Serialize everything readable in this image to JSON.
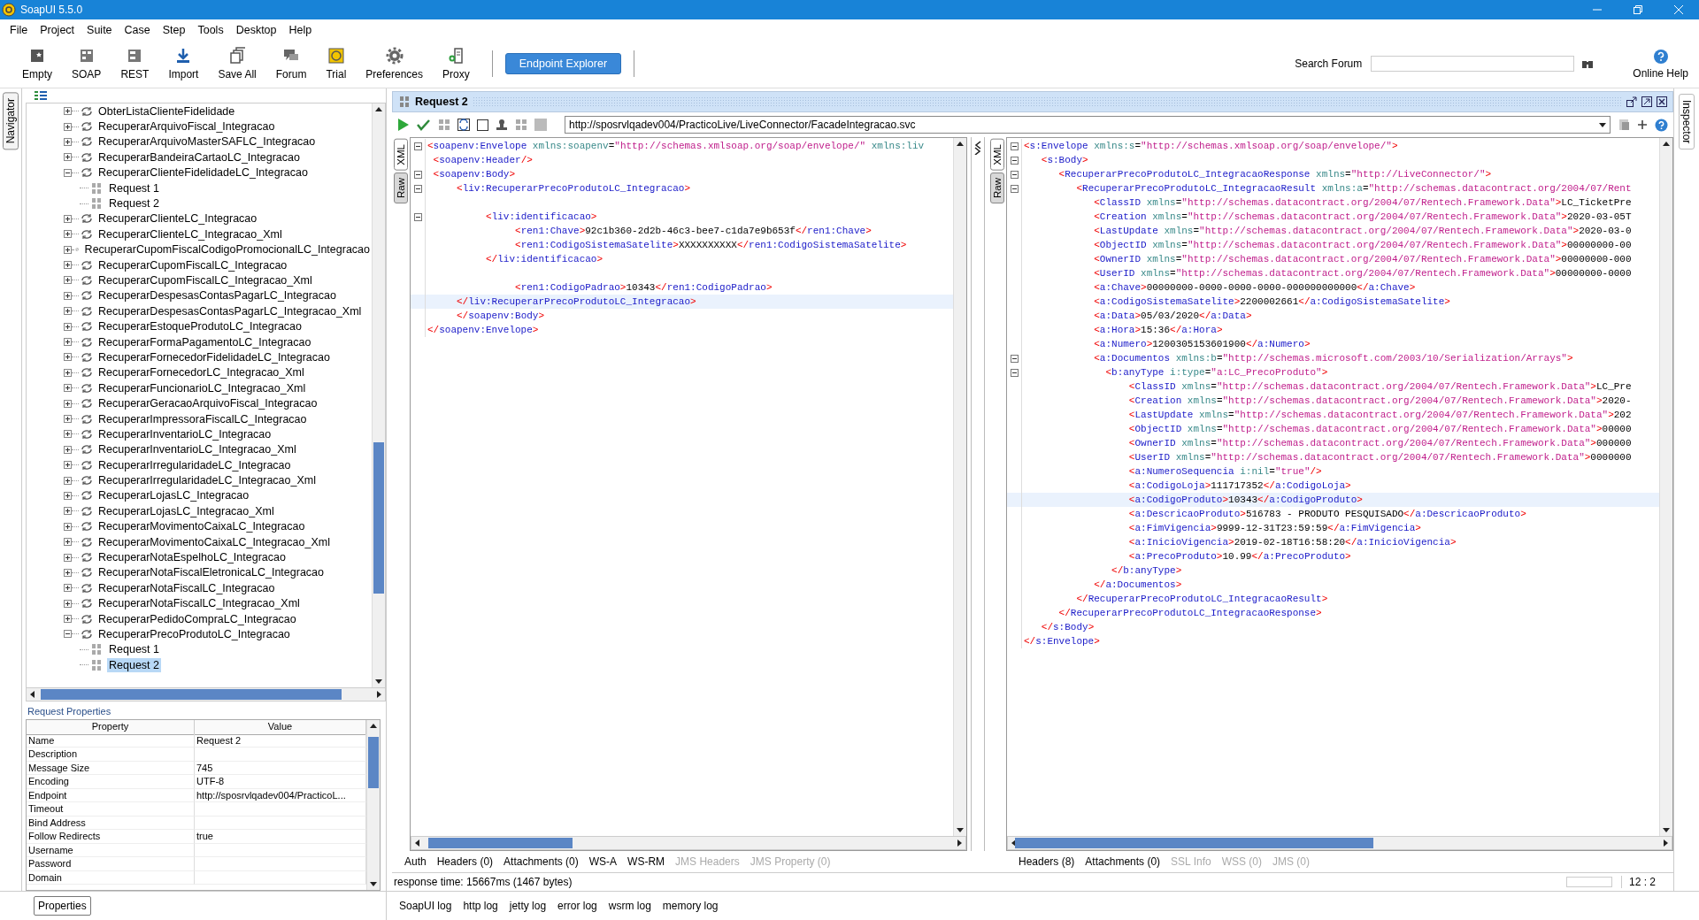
{
  "window": {
    "title": "SoapUI 5.5.0"
  },
  "menu": [
    "File",
    "Project",
    "Suite",
    "Case",
    "Step",
    "Tools",
    "Desktop",
    "Help"
  ],
  "toolbar": [
    "Empty",
    "SOAP",
    "REST",
    "Import",
    "Save All",
    "Forum",
    "Trial",
    "Preferences",
    "Proxy"
  ],
  "endpoint_explorer": "Endpoint Explorer",
  "search": {
    "label": "Search Forum"
  },
  "online_help": "Online Help",
  "navigator": {
    "tab": "Navigator",
    "items": [
      {
        "label": "ObterListaClienteFidelidade",
        "expanded": false,
        "selected": false
      },
      {
        "label": "RecuperarArquivoFiscal_Integracao",
        "expanded": false,
        "selected": false
      },
      {
        "label": "RecuperarArquivoMasterSAFLC_Integracao",
        "expanded": false,
        "selected": false
      },
      {
        "label": "RecuperarBandeiraCartaoLC_Integracao",
        "expanded": false,
        "selected": false
      },
      {
        "label": "RecuperarClienteFidelidadeLC_Integracao",
        "expanded": true,
        "selected": false,
        "children": [
          {
            "label": "Request 1",
            "selected": false
          },
          {
            "label": "Request 2",
            "selected": false
          }
        ]
      },
      {
        "label": "RecuperarClienteLC_Integracao",
        "expanded": false,
        "selected": false
      },
      {
        "label": "RecuperarClienteLC_Integracao_Xml",
        "expanded": false,
        "selected": false
      },
      {
        "label": "RecuperarCupomFiscalCodigoPromocionalLC_Integracao",
        "expanded": false,
        "selected": false
      },
      {
        "label": "RecuperarCupomFiscalLC_Integracao",
        "expanded": false,
        "selected": false
      },
      {
        "label": "RecuperarCupomFiscalLC_Integracao_Xml",
        "expanded": false,
        "selected": false
      },
      {
        "label": "RecuperarDespesasContasPagarLC_Integracao",
        "expanded": false,
        "selected": false
      },
      {
        "label": "RecuperarDespesasContasPagarLC_Integracao_Xml",
        "expanded": false,
        "selected": false
      },
      {
        "label": "RecuperarEstoqueProdutoLC_Integracao",
        "expanded": false,
        "selected": false
      },
      {
        "label": "RecuperarFormaPagamentoLC_Integracao",
        "expanded": false,
        "selected": false
      },
      {
        "label": "RecuperarFornecedorFidelidadeLC_Integracao",
        "expanded": false,
        "selected": false
      },
      {
        "label": "RecuperarFornecedorLC_Integracao_Xml",
        "expanded": false,
        "selected": false
      },
      {
        "label": "RecuperarFuncionarioLC_Integracao_Xml",
        "expanded": false,
        "selected": false
      },
      {
        "label": "RecuperarGeracaoArquivoFiscal_Integracao",
        "expanded": false,
        "selected": false
      },
      {
        "label": "RecuperarImpressoraFiscalLC_Integracao",
        "expanded": false,
        "selected": false
      },
      {
        "label": "RecuperarInventarioLC_Integracao",
        "expanded": false,
        "selected": false
      },
      {
        "label": "RecuperarInventarioLC_Integracao_Xml",
        "expanded": false,
        "selected": false
      },
      {
        "label": "RecuperarIrregularidadeLC_Integracao",
        "expanded": false,
        "selected": false
      },
      {
        "label": "RecuperarIrregularidadeLC_Integracao_Xml",
        "expanded": false,
        "selected": false
      },
      {
        "label": "RecuperarLojasLC_Integracao",
        "expanded": false,
        "selected": false
      },
      {
        "label": "RecuperarLojasLC_Integracao_Xml",
        "expanded": false,
        "selected": false
      },
      {
        "label": "RecuperarMovimentoCaixaLC_Integracao",
        "expanded": false,
        "selected": false
      },
      {
        "label": "RecuperarMovimentoCaixaLC_Integracao_Xml",
        "expanded": false,
        "selected": false
      },
      {
        "label": "RecuperarNotaEspelhoLC_Integracao",
        "expanded": false,
        "selected": false
      },
      {
        "label": "RecuperarNotaFiscalEletronicaLC_Integracao",
        "expanded": false,
        "selected": false
      },
      {
        "label": "RecuperarNotaFiscalLC_Integracao",
        "expanded": false,
        "selected": false
      },
      {
        "label": "RecuperarNotaFiscalLC_Integracao_Xml",
        "expanded": false,
        "selected": false
      },
      {
        "label": "RecuperarPedidoCompraLC_Integracao",
        "expanded": false,
        "selected": false
      },
      {
        "label": "RecuperarPrecoProdutoLC_Integracao",
        "expanded": true,
        "selected": false,
        "children": [
          {
            "label": "Request 1",
            "selected": false
          },
          {
            "label": "Request 2",
            "selected": true
          }
        ]
      }
    ]
  },
  "request_properties": {
    "title": "Request Properties",
    "columns": [
      "Property",
      "Value"
    ],
    "rows": [
      {
        "property": "Name",
        "value": "Request 2"
      },
      {
        "property": "Description"
      },
      {
        "property": "Message Size",
        "value": "745"
      },
      {
        "property": "Encoding",
        "value": "UTF-8"
      },
      {
        "property": "Endpoint",
        "value": "http://sposrvlqadev004/PracticoL..."
      },
      {
        "property": "Timeout"
      },
      {
        "property": "Bind Address"
      },
      {
        "property": "Follow Redirects",
        "value": "true"
      },
      {
        "property": "Username"
      },
      {
        "property": "Password"
      },
      {
        "property": "Domain"
      }
    ]
  },
  "properties_button": "Properties",
  "request": {
    "title": "Request 2",
    "endpoint": "http://sposrvlqadev004/PracticoLive/LiveConnector/FacadeIntegracao.svc",
    "editor_tabs": [
      {
        "label": "XML",
        "selected": true
      },
      {
        "label": "Raw",
        "selected": false
      }
    ],
    "lines": [
      {
        "text": "<soapenv:Envelope xmlns:soapenv=\"http://schemas.xmlsoap.org/soap/envelope/\" xmlns:liv",
        "fold": true,
        "current": false
      },
      {
        "text": " <soapenv:Header/>",
        "fold": false,
        "current": false
      },
      {
        "text": " <soapenv:Body>",
        "fold": true,
        "current": false
      },
      {
        "text": "     <liv:RecuperarPrecoProdutoLC_Integracao>",
        "fold": true,
        "current": false
      },
      {
        "fold": false,
        "current": false
      },
      {
        "text": "          <liv:identificacao>",
        "fold": true,
        "current": false
      },
      {
        "text": "               <ren1:Chave>92c1b360-2d2b-46c3-bee7-c1da7e9b653f</ren1:Chave>",
        "fold": false,
        "current": false
      },
      {
        "text": "               <ren1:CodigoSistemaSatelite>XXXXXXXXXX</ren1:CodigoSistemaSatelite>",
        "fold": false,
        "current": false
      },
      {
        "text": "          </liv:identificacao>",
        "fold": false,
        "current": false
      },
      {
        "fold": false,
        "current": false
      },
      {
        "text": "               <ren1:CodigoPadrao>10343</ren1:CodigoPadrao>",
        "fold": false,
        "current": false
      },
      {
        "text": "     </liv:RecuperarPrecoProdutoLC_Integracao>",
        "fold": false,
        "current": true
      },
      {
        "text": "     </soapenv:Body>",
        "fold": false,
        "current": false
      },
      {
        "text": "</soapenv:Envelope>",
        "fold": false,
        "current": false
      }
    ],
    "tabs": [
      {
        "label": "Auth",
        "disabled": false
      },
      {
        "label": "Headers (0)",
        "disabled": false
      },
      {
        "label": "Attachments (0)",
        "disabled": false
      },
      {
        "label": "WS-A",
        "disabled": false
      },
      {
        "label": "WS-RM",
        "disabled": false
      },
      {
        "label": "JMS Headers",
        "disabled": true
      },
      {
        "label": "JMS Property (0)",
        "disabled": true
      }
    ]
  },
  "response": {
    "editor_tabs": [
      {
        "label": "XML",
        "selected": true
      },
      {
        "label": "Raw",
        "selected": false
      }
    ],
    "lines": [
      {
        "text": "<s:Envelope xmlns:s=\"http://schemas.xmlsoap.org/soap/envelope/\">",
        "fold": true,
        "current": false
      },
      {
        "text": "   <s:Body>",
        "fold": true,
        "current": false
      },
      {
        "text": "      <RecuperarPrecoProdutoLC_IntegracaoResponse xmlns=\"http://LiveConnector/\">",
        "fold": true,
        "current": false
      },
      {
        "text": "         <RecuperarPrecoProdutoLC_IntegracaoResult xmlns:a=\"http://schemas.datacontract.org/2004/07/Rent",
        "fold": true,
        "current": false
      },
      {
        "text": "            <ClassID xmlns=\"http://schemas.datacontract.org/2004/07/Rentech.Framework.Data\">LC_TicketPre",
        "fold": false,
        "current": false
      },
      {
        "text": "            <Creation xmlns=\"http://schemas.datacontract.org/2004/07/Rentech.Framework.Data\">2020-03-05T",
        "fold": false,
        "current": false
      },
      {
        "text": "            <LastUpdate xmlns=\"http://schemas.datacontract.org/2004/07/Rentech.Framework.Data\">2020-03-0",
        "fold": false,
        "current": false
      },
      {
        "text": "            <ObjectID xmlns=\"http://schemas.datacontract.org/2004/07/Rentech.Framework.Data\">00000000-00",
        "fold": false,
        "current": false
      },
      {
        "text": "            <OwnerID xmlns=\"http://schemas.datacontract.org/2004/07/Rentech.Framework.Data\">00000000-000",
        "fold": false,
        "current": false
      },
      {
        "text": "            <UserID xmlns=\"http://schemas.datacontract.org/2004/07/Rentech.Framework.Data\">00000000-0000",
        "fold": false,
        "current": false
      },
      {
        "text": "            <a:Chave>00000000-0000-0000-0000-000000000000</a:Chave>",
        "fold": false,
        "current": false
      },
      {
        "text": "            <a:CodigoSistemaSatelite>2200002661</a:CodigoSistemaSatelite>",
        "fold": false,
        "current": false
      },
      {
        "text": "            <a:Data>05/03/2020</a:Data>",
        "fold": false,
        "current": false
      },
      {
        "text": "            <a:Hora>15:36</a:Hora>",
        "fold": false,
        "current": false
      },
      {
        "text": "            <a:Numero>1200305153601900</a:Numero>",
        "fold": false,
        "current": false
      },
      {
        "text": "            <a:Documentos xmlns:b=\"http://schemas.microsoft.com/2003/10/Serialization/Arrays\">",
        "fold": true,
        "current": false
      },
      {
        "text": "              <b:anyType i:type=\"a:LC_PrecoProduto\">",
        "fold": true,
        "current": false
      },
      {
        "text": "                  <ClassID xmlns=\"http://schemas.datacontract.org/2004/07/Rentech.Framework.Data\">LC_Pre",
        "fold": false,
        "current": false
      },
      {
        "text": "                  <Creation xmlns=\"http://schemas.datacontract.org/2004/07/Rentech.Framework.Data\">2020-",
        "fold": false,
        "current": false
      },
      {
        "text": "                  <LastUpdate xmlns=\"http://schemas.datacontract.org/2004/07/Rentech.Framework.Data\">202",
        "fold": false,
        "current": false
      },
      {
        "text": "                  <ObjectID xmlns=\"http://schemas.datacontract.org/2004/07/Rentech.Framework.Data\">00000",
        "fold": false,
        "current": false
      },
      {
        "text": "                  <OwnerID xmlns=\"http://schemas.datacontract.org/2004/07/Rentech.Framework.Data\">000000",
        "fold": false,
        "current": false
      },
      {
        "text": "                  <UserID xmlns=\"http://schemas.datacontract.org/2004/07/Rentech.Framework.Data\">0000000",
        "fold": false,
        "current": false
      },
      {
        "text": "                  <a:NumeroSequencia i:nil=\"true\"/>",
        "fold": false,
        "current": false
      },
      {
        "text": "                  <a:CodigoLoja>111717352</a:CodigoLoja>",
        "fold": false,
        "current": false
      },
      {
        "text": "                  <a:CodigoProduto>10343</a:CodigoProduto>",
        "fold": false,
        "current": true
      },
      {
        "text": "                  <a:DescricaoProduto>516783 - PRODUTO PESQUISADO</a:DescricaoProduto>",
        "fold": false,
        "current": false
      },
      {
        "text": "                  <a:FimVigencia>9999-12-31T23:59:59</a:FimVigencia>",
        "fold": false,
        "current": false
      },
      {
        "text": "                  <a:InicioVigencia>2019-02-18T16:58:20</a:InicioVigencia>",
        "fold": false,
        "current": false
      },
      {
        "text": "                  <a:PrecoProduto>10.99</a:PrecoProduto>",
        "fold": false,
        "current": false
      },
      {
        "text": "               </b:anyType>",
        "fold": false,
        "current": false
      },
      {
        "text": "            </a:Documentos>",
        "fold": false,
        "current": false
      },
      {
        "text": "         </RecuperarPrecoProdutoLC_IntegracaoResult>",
        "fold": false,
        "current": false
      },
      {
        "text": "      </RecuperarPrecoProdutoLC_IntegracaoResponse>",
        "fold": false,
        "current": false
      },
      {
        "text": "   </s:Body>",
        "fold": false,
        "current": false
      },
      {
        "text": "</s:Envelope>",
        "fold": false,
        "current": false
      }
    ],
    "tabs": [
      {
        "label": "Headers (8)",
        "disabled": false
      },
      {
        "label": "Attachments (0)",
        "disabled": false
      },
      {
        "label": "SSL Info",
        "disabled": true
      },
      {
        "label": "WSS (0)",
        "disabled": true
      },
      {
        "label": "JMS (0)",
        "disabled": true
      }
    ]
  },
  "status": {
    "response_time": "response time: 15667ms (1467 bytes)",
    "position": "12 : 2"
  },
  "log_tabs": [
    "SoapUI log",
    "http log",
    "jetty log",
    "error log",
    "wsrm log",
    "memory log"
  ],
  "inspector": {
    "tab": "Inspector"
  }
}
